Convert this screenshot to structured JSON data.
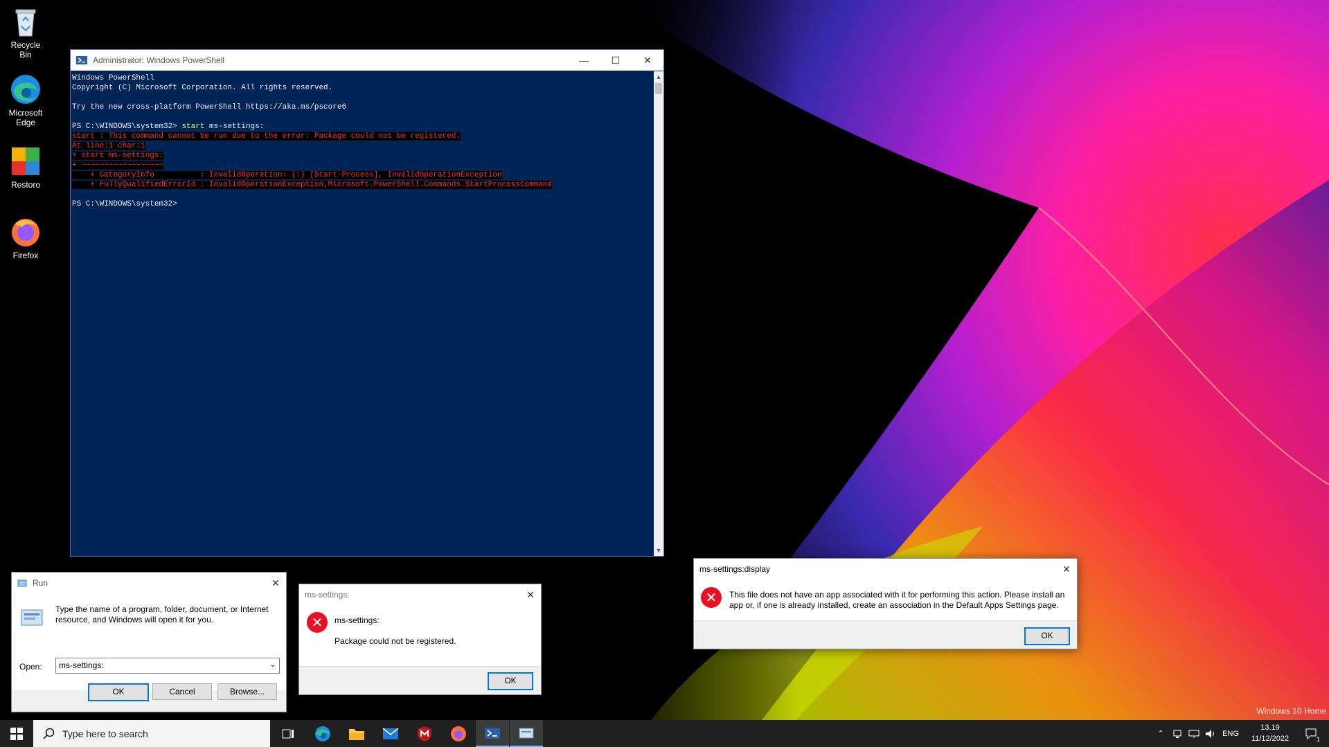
{
  "desktop": {
    "icons": [
      {
        "label": "Recycle Bin"
      },
      {
        "label": "Microsoft Edge"
      },
      {
        "label": "Restoro"
      },
      {
        "label": "Firefox"
      }
    ],
    "watermark": "Windows 10 Home"
  },
  "powershell": {
    "title": "Administrator: Windows PowerShell",
    "lines": [
      {
        "text": "Windows PowerShell",
        "style": "normal"
      },
      {
        "text": "Copyright (C) Microsoft Corporation. All rights reserved.",
        "style": "normal"
      },
      {
        "text": "",
        "style": "normal"
      },
      {
        "text": "Try the new cross-platform PowerShell https://aka.ms/pscore6",
        "style": "normal"
      },
      {
        "text": "",
        "style": "normal"
      },
      {
        "prompt": "PS C:\\WINDOWS\\system32> ",
        "cmd": "start",
        "rest": " ms-settings:",
        "style": "prompt"
      },
      {
        "text": "start : This command cannot be run due to the error: Package could not be registered.",
        "style": "err"
      },
      {
        "text": "At line:1 char:1",
        "style": "err"
      },
      {
        "text": "+ start ms-settings:",
        "style": "err"
      },
      {
        "text": "+ ~~~~~~~~~~~~~~~~~~",
        "style": "err"
      },
      {
        "text": "    + CategoryInfo          : InvalidOperation: (:) [Start-Process], InvalidOperationException",
        "style": "err"
      },
      {
        "text": "    + FullyQualifiedErrorId : InvalidOperationException,Microsoft.PowerShell.Commands.StartProcessCommand",
        "style": "err"
      },
      {
        "text": "",
        "style": "normal"
      },
      {
        "text": "PS C:\\WINDOWS\\system32>",
        "style": "normal"
      }
    ]
  },
  "run": {
    "title": "Run",
    "description": "Type the name of a program, folder, document, or Internet resource, and Windows will open it for you.",
    "open_label": "Open:",
    "open_value": "ms-settings:",
    "ok": "OK",
    "cancel": "Cancel",
    "browse": "Browse..."
  },
  "ms_settings_error": {
    "title": "ms-settings:",
    "heading": "ms-settings:",
    "message": "Package could not be registered.",
    "ok": "OK"
  },
  "display_error": {
    "title": "ms-settings:display",
    "message": "This file does not have an app associated with it for performing this action. Please install an app or, if one is already installed, create an association in the Default Apps Settings page.",
    "ok": "OK"
  },
  "taskbar": {
    "search_placeholder": "Type here to search",
    "language": "ENG",
    "time": "13.19",
    "date": "11/12/2022",
    "notification_count": "1"
  }
}
